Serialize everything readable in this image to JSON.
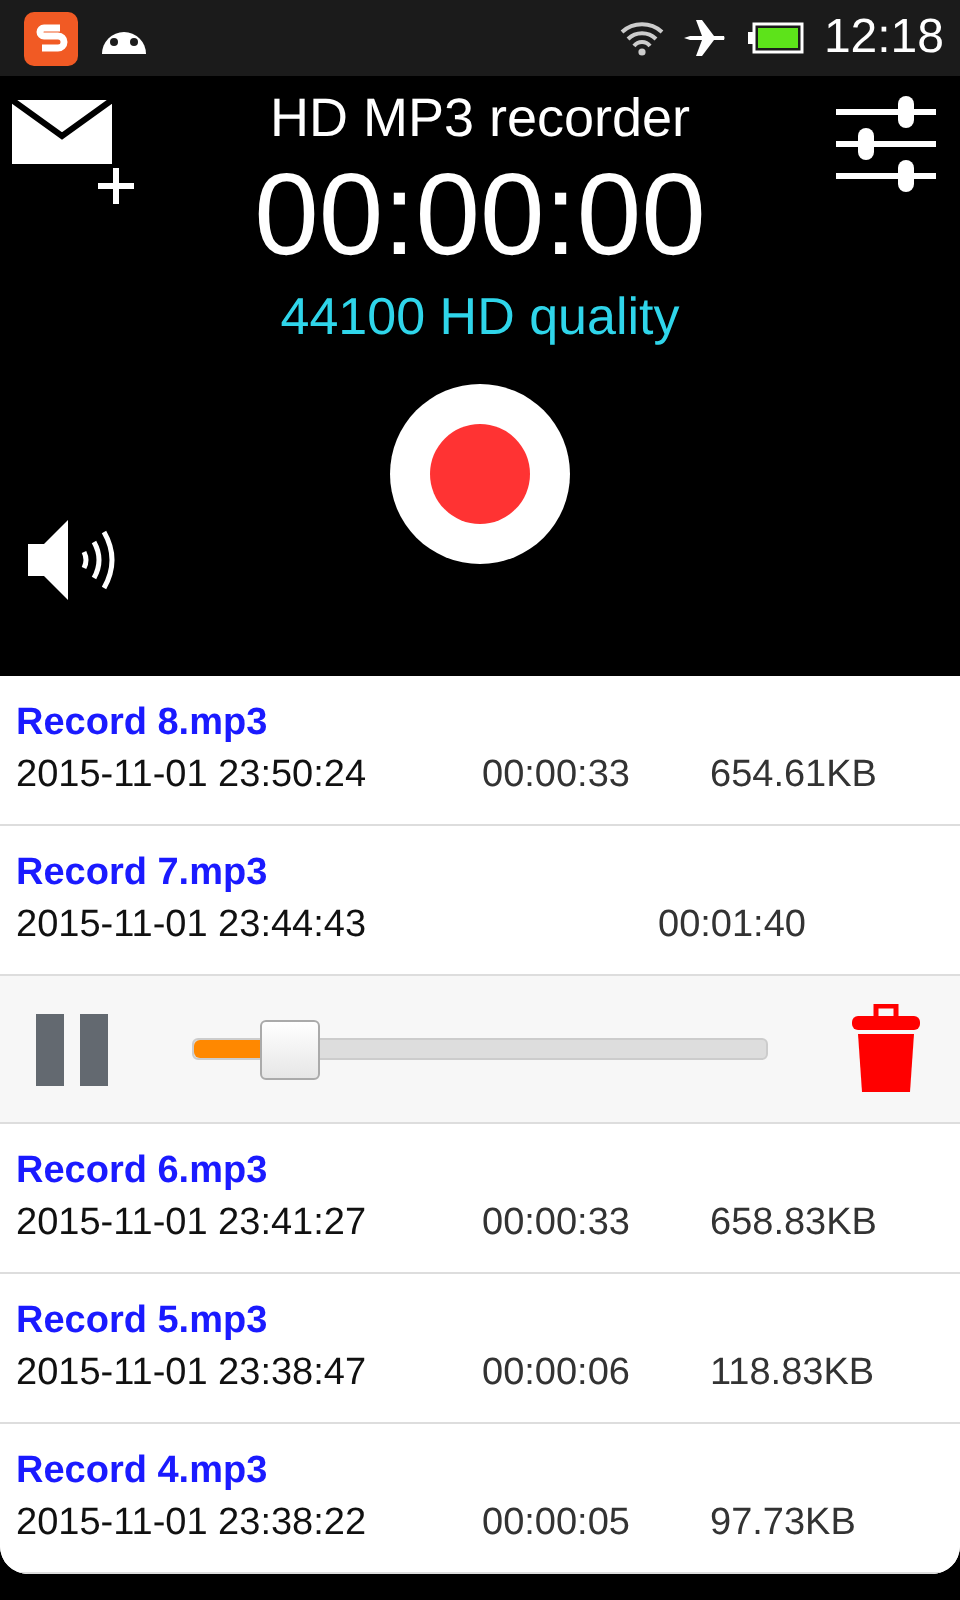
{
  "status_bar": {
    "time": "12:18"
  },
  "header": {
    "title": "HD MP3 recorder",
    "timer": "00:00:00",
    "quality": "44100 HD quality",
    "recording": false
  },
  "records": [
    {
      "name": "Record 8.mp3",
      "date": "2015-11-01 23:50:24",
      "duration": "00:00:33",
      "size": "654.61KB"
    },
    {
      "name": "Record 7.mp3",
      "date": "2015-11-01 23:44:43",
      "duration": "00:01:40",
      "player": {
        "playing": true,
        "level": 0.17
      }
    },
    {
      "name": "Record 6.mp3",
      "date": "2015-11-01 23:41:27",
      "duration": "00:00:33",
      "size": "658.83KB"
    },
    {
      "name": "Record 5.mp3",
      "date": "2015-11-01 23:38:47",
      "duration": "00:00:06",
      "size": "118.83KB"
    },
    {
      "name": "Record 4.mp3",
      "date": "2015-11-01 23:38:22",
      "duration": "00:00:05",
      "size": "97.73KB"
    }
  ]
}
